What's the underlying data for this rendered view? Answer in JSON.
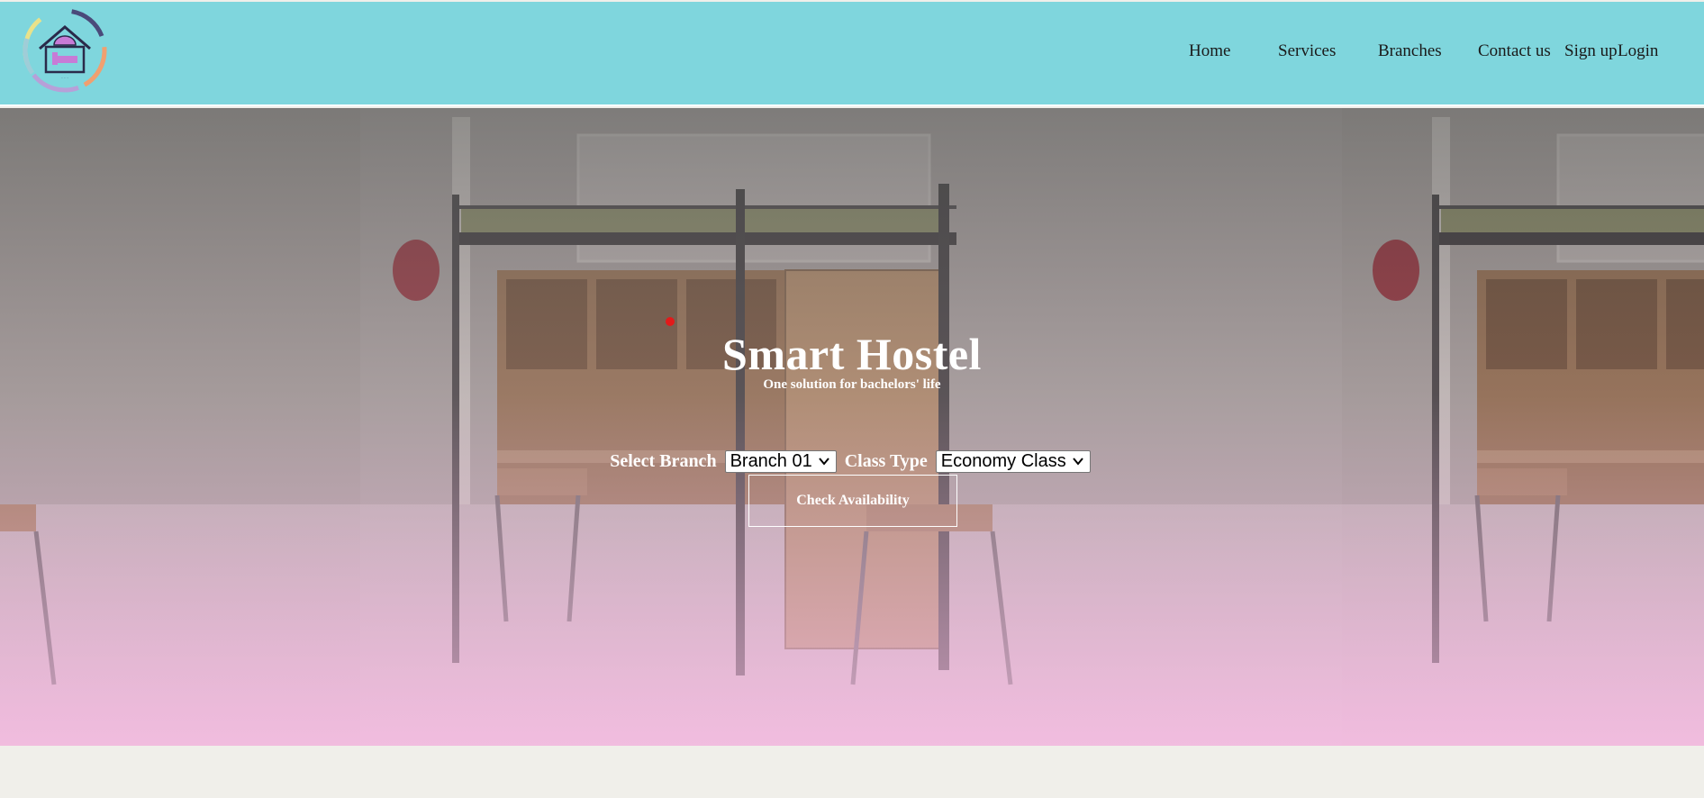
{
  "brand": {
    "logo_icon": "hostel-house-bed-logo"
  },
  "nav": {
    "items": [
      {
        "label": "Home"
      },
      {
        "label": "Services"
      },
      {
        "label": "Branches"
      },
      {
        "label": "Contact us"
      },
      {
        "label": "Sign up"
      },
      {
        "label": "Login"
      }
    ]
  },
  "hero": {
    "title": "Smart Hostel",
    "subtitle": "One solution for bachelors' life",
    "background_icon": "hostel-room-bunk-bed-photo"
  },
  "form": {
    "branch_label": "Select Branch",
    "branch_value": "Branch 01",
    "class_label": "Class Type",
    "class_value": "Economy Class",
    "check_button": "Check Availability"
  },
  "colors": {
    "navbar": "#7fd6dd",
    "hero_gradient_bottom": "#f0b4dc",
    "page_bg": "#f0efea"
  }
}
